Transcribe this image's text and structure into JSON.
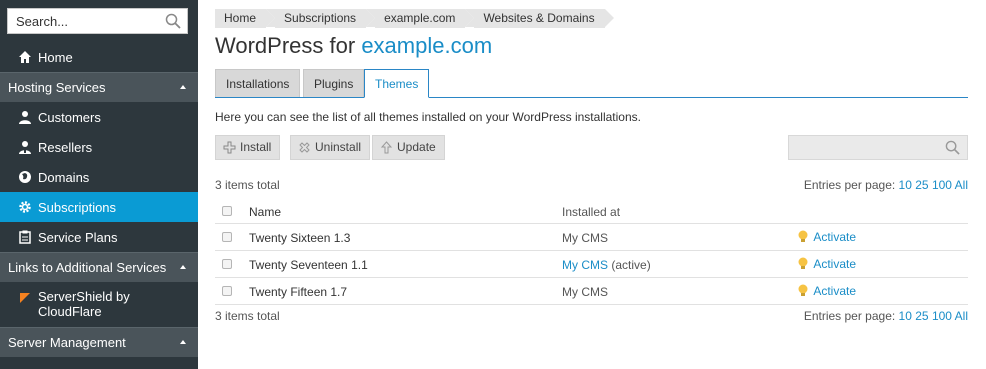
{
  "sidebar": {
    "search_placeholder": "Search...",
    "home": "Home",
    "hosting_services": "Hosting Services",
    "customers": "Customers",
    "resellers": "Resellers",
    "domains": "Domains",
    "subscriptions": "Subscriptions",
    "service_plans": "Service Plans",
    "links_section": "Links to Additional Services",
    "servershield": "ServerShield by CloudFlare",
    "server_management": "Server Management"
  },
  "breadcrumb": [
    "Home",
    "Subscriptions",
    "example.com",
    "Websites & Domains"
  ],
  "title": {
    "prefix": "WordPress for",
    "domain": "example.com"
  },
  "tabs": [
    "Installations",
    "Plugins",
    "Themes"
  ],
  "active_tab": "Themes",
  "description": "Here you can see the list of all themes installed on your WordPress installations.",
  "toolbar": {
    "install": "Install",
    "uninstall": "Uninstall",
    "update": "Update"
  },
  "summary": {
    "total": "3 items total",
    "per_page_label": "Entries per page:",
    "per_page_options": [
      "10",
      "25",
      "100",
      "All"
    ]
  },
  "table": {
    "columns": {
      "name": "Name",
      "installed_at": "Installed at"
    },
    "rows": [
      {
        "name": "Twenty Sixteen 1.3",
        "installed_at": "My CMS",
        "installed_at_link": false,
        "status": "",
        "action": "Activate"
      },
      {
        "name": "Twenty Seventeen 1.1",
        "installed_at": "My CMS",
        "installed_at_link": true,
        "status": "(active)",
        "action": "Activate"
      },
      {
        "name": "Twenty Fifteen 1.7",
        "installed_at": "My CMS",
        "installed_at_link": false,
        "status": "",
        "action": "Activate"
      }
    ]
  },
  "colors": {
    "sidebar_bg": "#2d373d",
    "section_bg": "#4a545a",
    "active_bg": "#0a9bd4",
    "link": "#1a8dc7"
  }
}
